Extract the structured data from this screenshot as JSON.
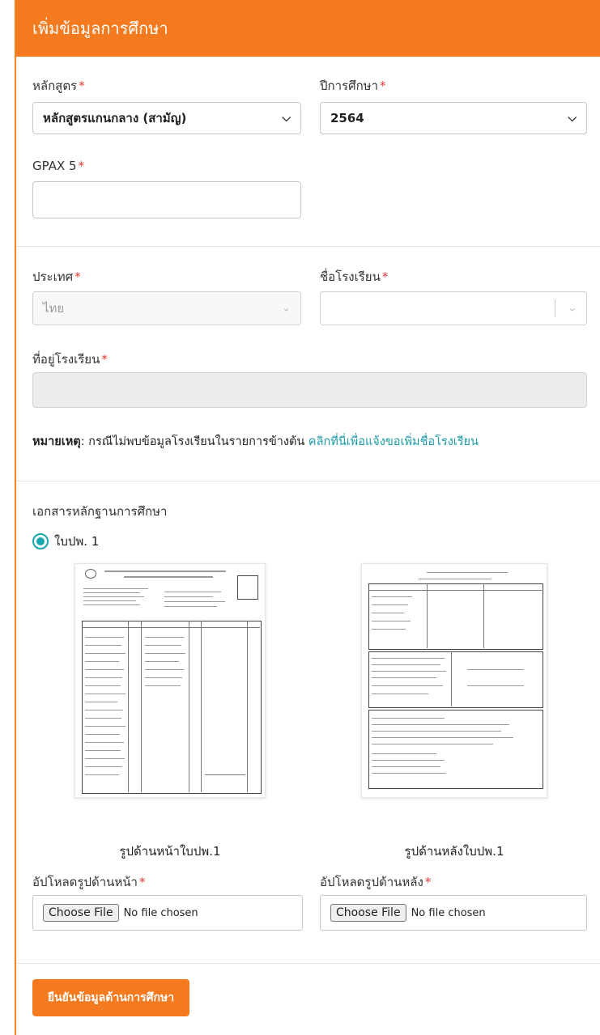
{
  "header": {
    "title": "เพิ่มข้อมูลการศึกษา"
  },
  "form": {
    "curriculum_label": "หลักสูตร",
    "curriculum_value": "หลักสูตรแกนกลาง (สามัญ)",
    "year_label": "ปีการศึกษา",
    "year_value": "2564",
    "gpax_label": "GPAX 5",
    "gpax_value": "",
    "country_label": "ประเทศ",
    "country_value": "ไทย",
    "school_label": "ชื่อโรงเรียน",
    "school_value": "",
    "address_label": "ที่อยู่โรงเรียน",
    "address_value": "",
    "required_mark": "*"
  },
  "note": {
    "prefix": "หมายเหตุ",
    "text": ": กรณีไม่พบข้อมูลโรงเรียนในรายการข้างต้น ",
    "link": "คลิกที่นี่เพื่อแจ้งขอเพิ่มชื่อโรงเรียน"
  },
  "evidence": {
    "title": "เอกสารหลักฐานการศึกษา",
    "option_label": "ใบปพ. 1",
    "front_caption": "รูปด้านหน้าใบปพ.1",
    "back_caption": "รูปด้านหลังใบปพ.1",
    "upload_front_label": "อัปโหลดรูปด้านหน้า",
    "upload_back_label": "อัปโหลดรูปด้านหลัง",
    "choose_file": "Choose File",
    "no_file": "No file chosen"
  },
  "submit": {
    "label": "ยืนยันข้อมูลด้านการศึกษา"
  },
  "colors": {
    "accent": "#f47a1f",
    "link": "#1a9aa6",
    "required": "#e53935"
  }
}
